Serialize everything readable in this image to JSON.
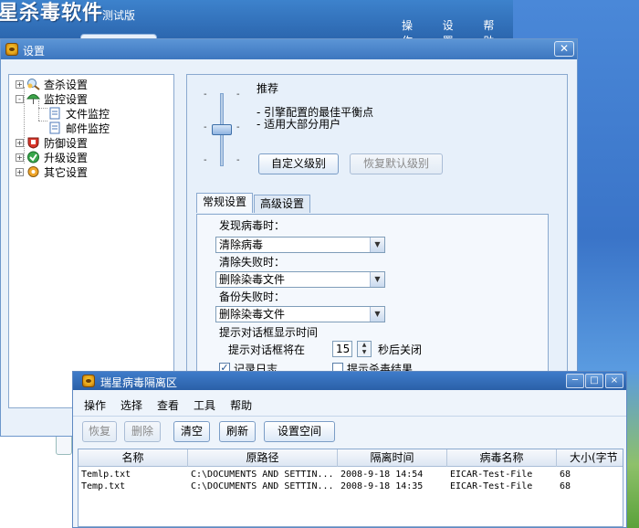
{
  "main_window": {
    "title": "星杀毒软件",
    "edition": "测试版",
    "menu": [
      "操作",
      "设置",
      "帮助"
    ]
  },
  "settings": {
    "title": "设置",
    "tree": [
      {
        "label": "查杀设置",
        "icon": "scan-settings-icon",
        "expander": "+"
      },
      {
        "label": "监控设置",
        "icon": "monitor-umbrella-icon",
        "expander": "-"
      },
      {
        "label": "文件监控",
        "icon": "file-monitor-icon",
        "selected": true
      },
      {
        "label": "邮件监控",
        "icon": "mail-monitor-icon"
      },
      {
        "label": "防御设置",
        "icon": "defense-shield-icon",
        "expander": "+"
      },
      {
        "label": "升级设置",
        "icon": "upgrade-icon",
        "expander": "+"
      },
      {
        "label": "其它设置",
        "icon": "other-settings-icon",
        "expander": "+"
      }
    ],
    "level": {
      "name": "推荐",
      "lines": [
        "- 引擎配置的最佳平衡点",
        "- 适用大部分用户"
      ],
      "custom_button": "自定义级别",
      "restore_button": "恢复默认级别",
      "tick": "-",
      "slider_level": 0.5
    },
    "tabs": [
      "常规设置",
      "高级设置"
    ],
    "form": {
      "virus_found_label": "发现病毒时：",
      "virus_found_value": "清除病毒",
      "clean_fail_label": "清除失败时：",
      "clean_fail_value": "删除染毒文件",
      "backup_fail_label": "备份失败时：",
      "backup_fail_value": "删除染毒文件",
      "dialog_time_label": "提示对话框显示时间",
      "dialog_prefix": "提示对话框将在",
      "dialog_seconds": "15",
      "dialog_suffix": "秒后关闭",
      "log_label": "记录日志",
      "log_checked": true,
      "result_label": "提示杀毒结果",
      "result_checked": false
    }
  },
  "quarantine": {
    "title": "瑞星病毒隔离区",
    "menu": [
      "操作",
      "选择",
      "查看",
      "工具",
      "帮助"
    ],
    "toolbar": {
      "restore": "恢复",
      "delete": "删除",
      "clear": "清空",
      "refresh": "刷新",
      "space": "设置空间"
    },
    "columns": [
      "名称",
      "原路径",
      "隔离时间",
      "病毒名称",
      "大小(字节"
    ],
    "rows": [
      [
        "Temlp.txt",
        "C:\\DOCUMENTS AND SETTIN...",
        "2008-9-18 14:54",
        "EICAR-Test-File",
        "68"
      ],
      [
        "Temp.txt",
        "C:\\DOCUMENTS AND SETTIN...",
        "2008-9-18 14:35",
        "EICAR-Test-File",
        "68"
      ]
    ],
    "window_buttons": {
      "minimize": "─",
      "maximize": "□",
      "close": "×"
    }
  },
  "colors": {
    "titlebar": "#3d76bf",
    "panel_bg": "#e9f1fa",
    "border": "#8aa9cf"
  }
}
